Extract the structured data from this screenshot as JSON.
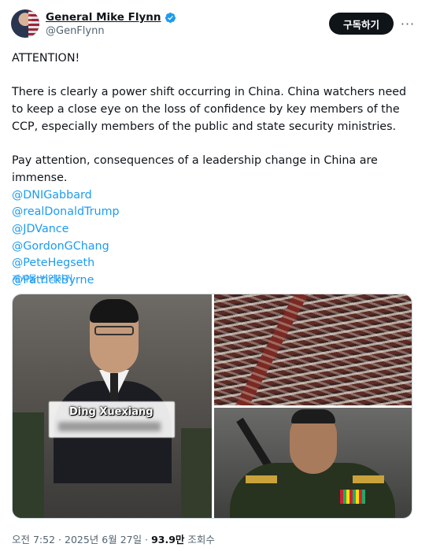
{
  "author": {
    "display_name": "General Mike Flynn",
    "handle": "@GenFlynn",
    "verified": true,
    "colors": {
      "verified_badge": "#1d9bf0"
    }
  },
  "actions": {
    "follow_label": "구독하기",
    "more_icon": "more-horizontal-icon"
  },
  "tweet": {
    "paragraphs": [
      "ATTENTION!",
      "There is clearly a power shift occurring in China. China watchers need to keep a close eye on the loss of confidence by key members of the CCP, especially members of the public and state security ministries.",
      "Pay attention, consequences of a leadership change in China are immense."
    ],
    "mentions": [
      "@DNIGabbard",
      "@realDonaldTrump",
      "@JDVance",
      "@GordonGChang",
      "@PeteHegseth",
      "@PatrickByrne"
    ],
    "translate_label": "게시물 번역하기",
    "link_color": "#1d9bf0"
  },
  "media": {
    "images": [
      {
        "caption": "Ding Xuexiang"
      },
      {},
      {}
    ]
  },
  "meta": {
    "time": "오전 7:52",
    "separator": "·",
    "date": "2025년 6월 27일",
    "views": "93.9만",
    "views_label": "조회수"
  }
}
